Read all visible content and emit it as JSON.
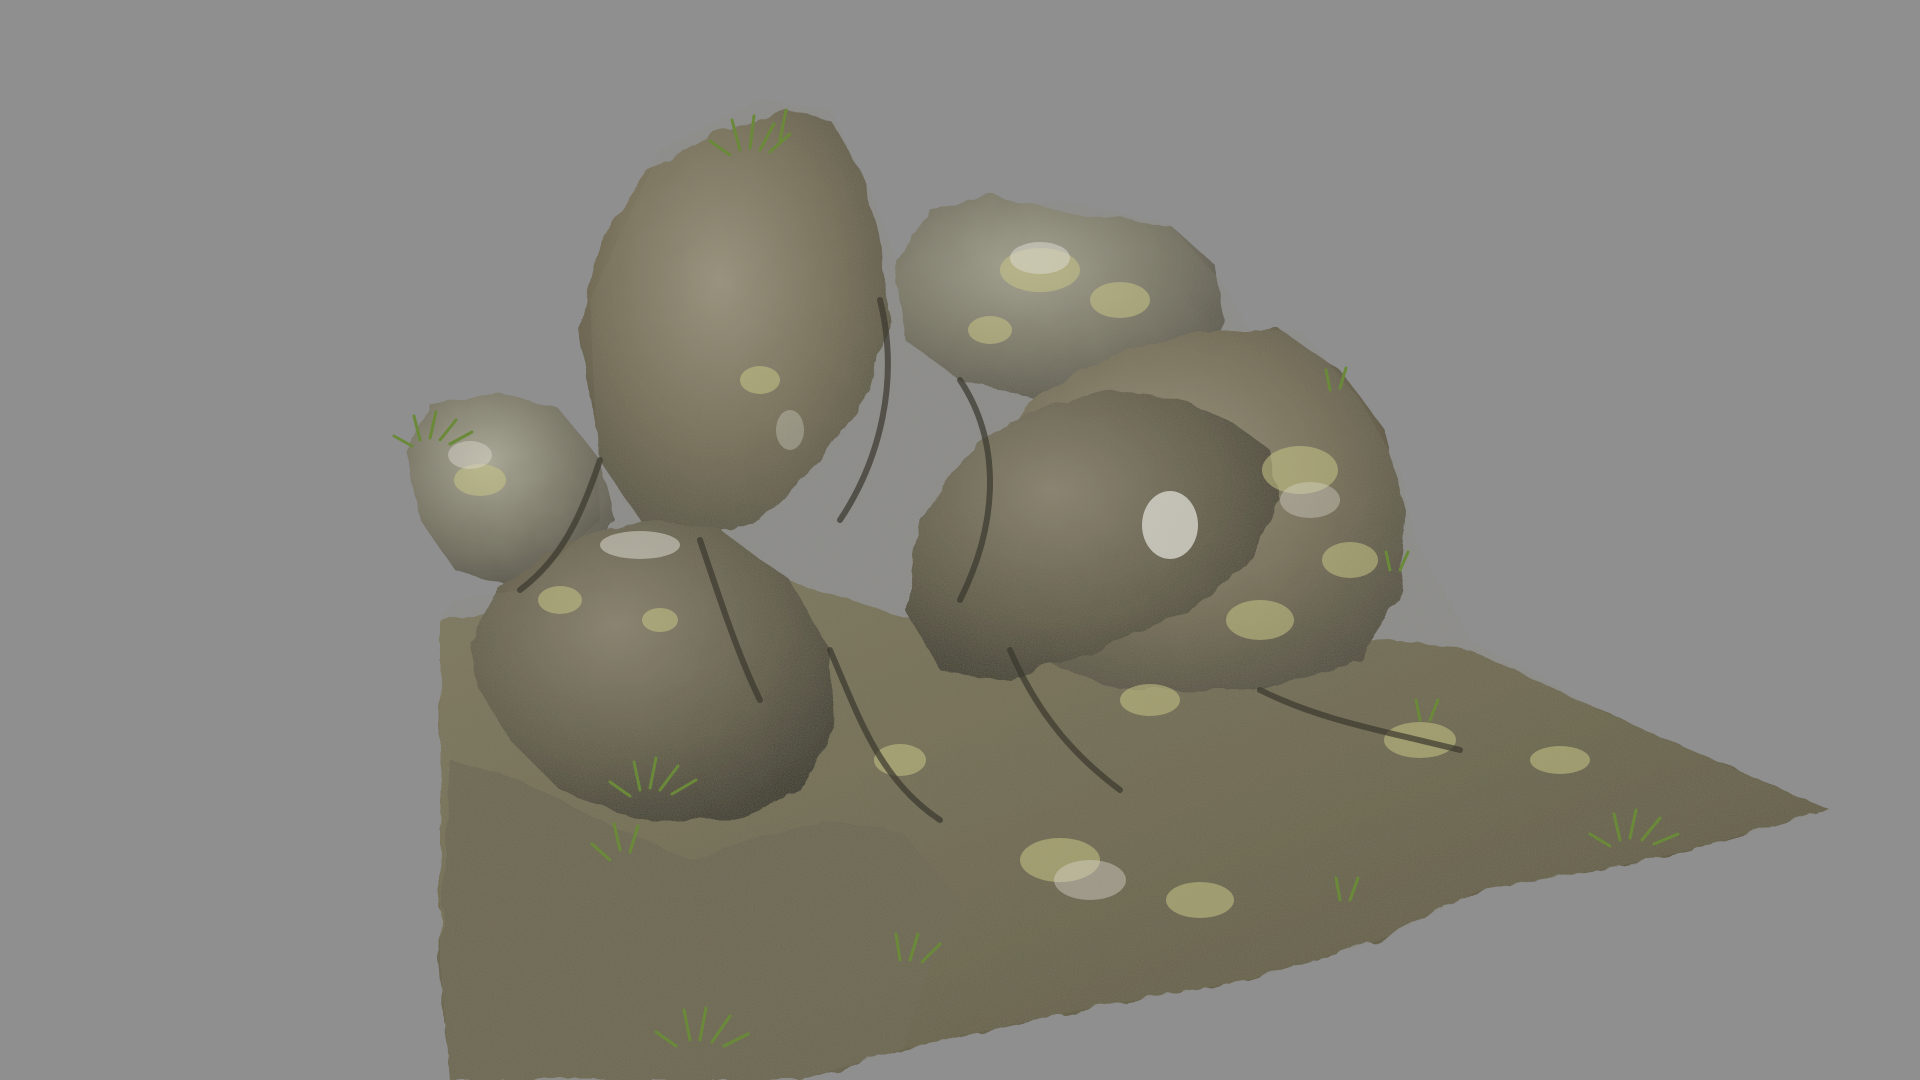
{
  "scene": {
    "background_color": "#8f8f8f",
    "subject": "rock-formation",
    "palette": {
      "stone_dark": "#4f4c40",
      "stone_mid": "#77705a",
      "stone_light": "#9c9680",
      "stone_highlight": "#d8d6cc",
      "moss": "#a5a656",
      "lichen": "#c7c487",
      "grass": "#6a8a3a",
      "shadow": "#3c3a30"
    }
  }
}
